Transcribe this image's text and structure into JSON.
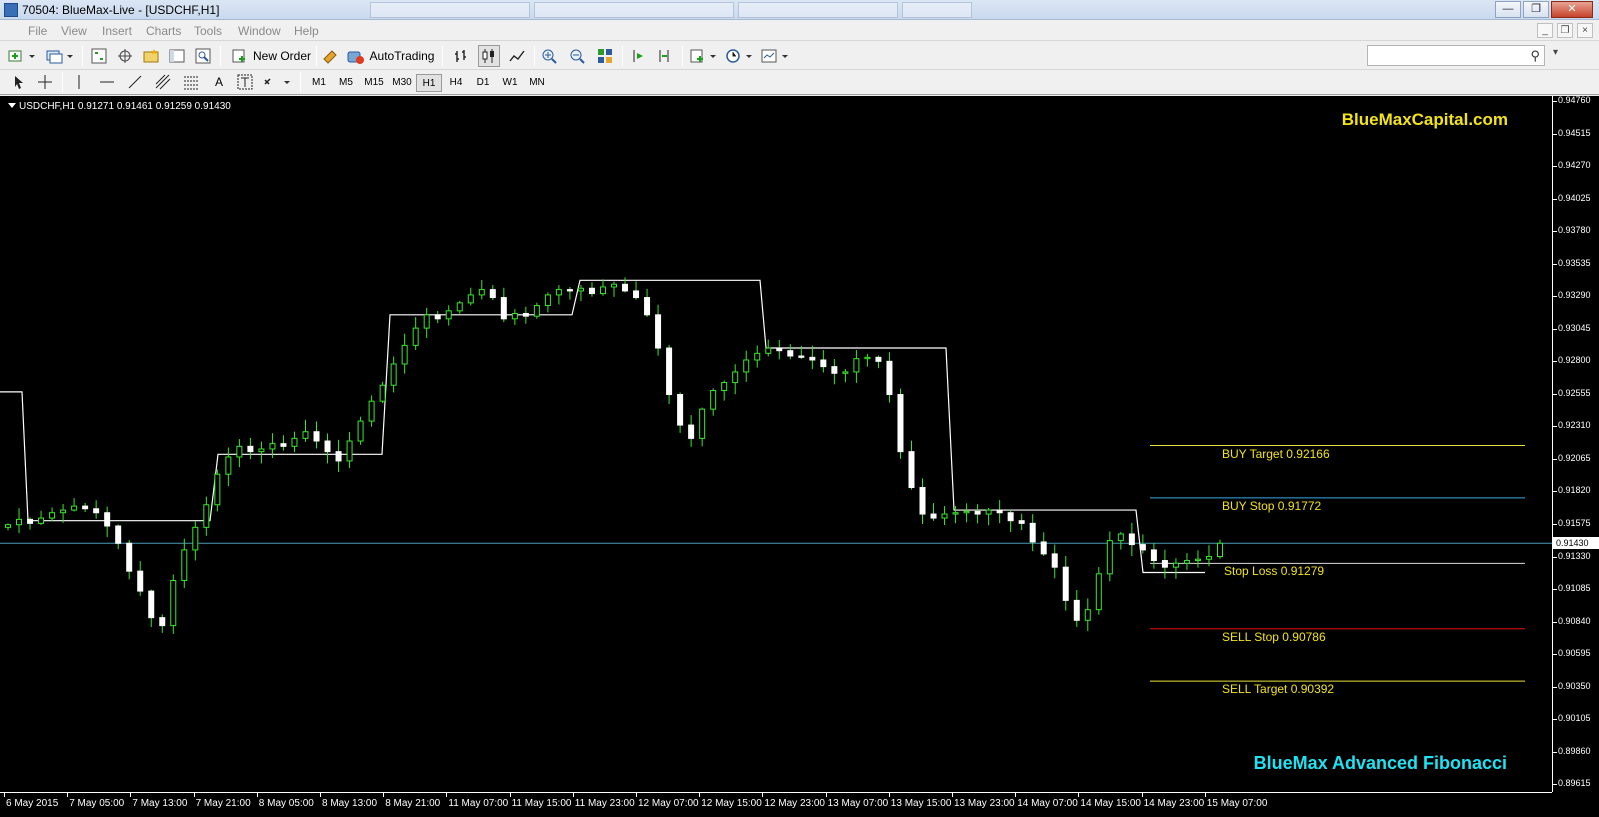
{
  "window": {
    "title": "70504: BlueMax-Live - [USDCHF,H1]",
    "background_tabs": [
      "",
      "",
      "",
      ""
    ]
  },
  "menu": [
    "File",
    "View",
    "Insert",
    "Charts",
    "Tools",
    "Window",
    "Help"
  ],
  "toolbar": {
    "new_order": "New Order",
    "auto_trading": "AutoTrading",
    "search_placeholder": ""
  },
  "timeframes": [
    "M1",
    "M5",
    "M15",
    "M30",
    "H1",
    "H4",
    "D1",
    "W1",
    "MN"
  ],
  "active_timeframe": "H1",
  "chart": {
    "symbol_label": "USDCHF,H1  0.91271 0.91461 0.91259 0.91430",
    "brand_top": "BlueMaxCapital.com",
    "brand_bottom": "BlueMax Advanced Fibonacci",
    "current_price": "0.91430",
    "price_labels": [
      "0.94760",
      "0.94515",
      "0.94270",
      "0.94025",
      "0.93780",
      "0.93535",
      "0.93290",
      "0.93045",
      "0.92800",
      "0.92555",
      "0.92310",
      "0.92065",
      "0.91820",
      "0.91575",
      "0.91330",
      "0.91085",
      "0.90840",
      "0.90595",
      "0.90350",
      "0.90105",
      "0.89860",
      "0.89615"
    ],
    "time_labels": [
      "6 May 2015",
      "7 May 05:00",
      "7 May 13:00",
      "7 May 21:00",
      "8 May 05:00",
      "8 May 13:00",
      "8 May 21:00",
      "11 May 07:00",
      "11 May 15:00",
      "11 May 23:00",
      "12 May 07:00",
      "12 May 15:00",
      "12 May 23:00",
      "13 May 07:00",
      "13 May 15:00",
      "13 May 23:00",
      "14 May 07:00",
      "14 May 15:00",
      "14 May 23:00",
      "15 May 07:00"
    ],
    "levels": [
      {
        "label": "BUY Target  0.92166",
        "price": 0.92166,
        "color": "#e8e03a"
      },
      {
        "label": "BUY Stop    0.91772",
        "price": 0.91772,
        "color": "#39a8e0"
      },
      {
        "label": "Stop Loss  0.91279",
        "price": 0.91279,
        "color": "#dddddd"
      },
      {
        "label": "SELL Stop   0.90786",
        "price": 0.90786,
        "color": "#e01010"
      },
      {
        "label": "SELL Target 0.90392",
        "price": 0.90392,
        "color": "#e8e03a"
      }
    ],
    "colors": {
      "background": "#000000",
      "bull": "#ffffff",
      "bear": "#ffffff",
      "wick": "#39e82a",
      "step_line": "#ffffff",
      "bid_line": "#4a9ab8",
      "brand_top": "#f2e31b",
      "brand_bottom": "#1fe2f2"
    }
  },
  "chart_data": {
    "type": "candlestick",
    "x_range": [
      "6 May 2015",
      "15 May 07:00"
    ],
    "ylim": [
      0.8955,
      0.9478
    ],
    "closes": [
      0.9157,
      0.9161,
      0.9158,
      0.9162,
      0.9166,
      0.9168,
      0.9171,
      0.9169,
      0.9166,
      0.9156,
      0.9143,
      0.9122,
      0.9107,
      0.9087,
      0.9081,
      0.9115,
      0.9138,
      0.9155,
      0.9172,
      0.9195,
      0.9208,
      0.9216,
      0.9212,
      0.9214,
      0.9218,
      0.9216,
      0.9222,
      0.9227,
      0.922,
      0.9212,
      0.9205,
      0.922,
      0.9235,
      0.925,
      0.9262,
      0.9278,
      0.9292,
      0.9305,
      0.9315,
      0.9312,
      0.9318,
      0.9324,
      0.933,
      0.9334,
      0.9328,
      0.9312,
      0.9316,
      0.9314,
      0.9322,
      0.933,
      0.9334,
      0.9333,
      0.9335,
      0.9331,
      0.9336,
      0.9338,
      0.9333,
      0.9328,
      0.9315,
      0.929,
      0.9255,
      0.9232,
      0.9222,
      0.9244,
      0.9258,
      0.9264,
      0.9272,
      0.9281,
      0.9286,
      0.929,
      0.9288,
      0.9284,
      0.9283,
      0.9281,
      0.9276,
      0.9271,
      0.9272,
      0.9282,
      0.9283,
      0.928,
      0.9255,
      0.9212,
      0.9185,
      0.9165,
      0.9162,
      0.9165,
      0.9166,
      0.9167,
      0.9165,
      0.9168,
      0.9166,
      0.916,
      0.9158,
      0.9144,
      0.9135,
      0.9125,
      0.91,
      0.9085,
      0.9093,
      0.912,
      0.9145,
      0.915,
      0.9142,
      0.9138,
      0.913,
      0.9125,
      0.9128,
      0.913,
      0.9131,
      0.9133,
      0.9143
    ]
  }
}
